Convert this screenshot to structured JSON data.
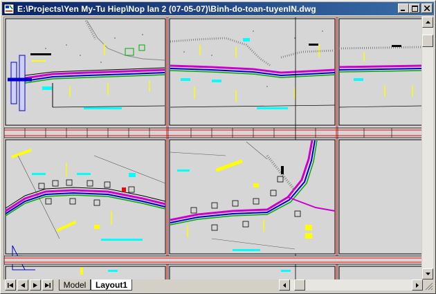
{
  "window": {
    "title": "E:\\Projects\\Yen My-Tu Hiep\\Nop lan 2 (07-05-07)\\Binh-do-toan-tuyenIN.dwg",
    "icon": "autocad-drawing-icon",
    "buttons": [
      "minimize-icon",
      "maximize-icon",
      "close-icon"
    ]
  },
  "layout_tabs": [
    {
      "label": "Model",
      "active": false
    },
    {
      "label": "Layout1",
      "active": true
    }
  ],
  "tab_navigation": [
    "first-tab-icon",
    "previous-tab-icon",
    "next-tab-icon",
    "last-tab-icon"
  ],
  "colors": {
    "titlebar_start": "#0a246a",
    "titlebar_end": "#3a6ea5",
    "canvas_background": "#d6d6d6",
    "road_magenta": "#cc00cc",
    "road_blue": "#0000cc",
    "road_green": "#00aa00",
    "annotation_yellow": "#ffff00",
    "annotation_cyan": "#00ffff",
    "frame_red": "#ff0000"
  }
}
